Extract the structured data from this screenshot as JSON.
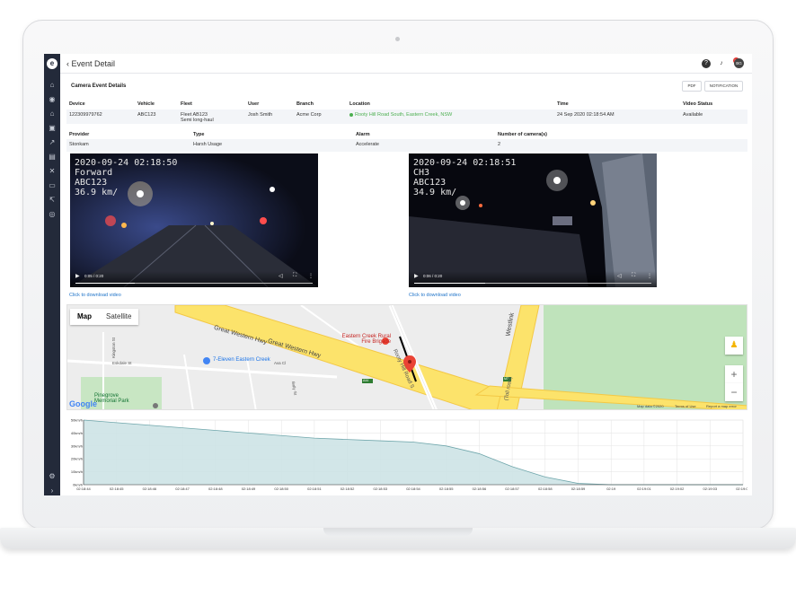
{
  "header": {
    "page_title": "Event Detail",
    "back_icon": "chevron-left-icon",
    "notification_count": "10",
    "avatar_initials": "BG",
    "help_icon": "question-icon",
    "bell_icon": "bell-icon"
  },
  "sidebar": {
    "logo": "e",
    "icons": [
      "home-icon",
      "globe-icon",
      "house-icon",
      "car-icon",
      "chart-icon",
      "document-icon",
      "tools-icon",
      "card-icon",
      "share-icon",
      "support-icon"
    ],
    "bottom_icons": [
      "gear-icon",
      "expand-icon"
    ]
  },
  "event": {
    "section_title": "Camera Event Details",
    "pdf_button": "PDF",
    "notification_button": "NOTIFICATION",
    "headers": [
      "Device",
      "Vehicle",
      "Fleet",
      "User",
      "Branch",
      "Location",
      "Time",
      "Video Status"
    ],
    "device": "122309979762",
    "vehicle": "ABC123",
    "fleet_line1": "Fleet AB123",
    "fleet_line2": "Semi long-haul",
    "user": "Josh Smith",
    "branch": "Acme Corp",
    "location": "Rooty Hill Road South, Eastern Creek, NSW",
    "time": "24 Sep 2020 02:18:54 AM",
    "video_status": "Available",
    "headers2": [
      "Provider",
      "Type",
      "Alarm",
      "Number of camera(s)"
    ],
    "provider": "Stonkam",
    "type": "Harsh Usage",
    "alarm": "Accelerate",
    "camera_count": "2"
  },
  "videos": [
    {
      "overlay": "2020-09-24 02:18:50\nForward\nABC123\n36.9 km/",
      "time": "0:05 / 0:20",
      "progress": 0.25,
      "download": "Click to download video"
    },
    {
      "overlay": "2020-09-24 02:18:51\nCH3\nABC123\n34.9 km/",
      "time": "0:06 / 0:20",
      "progress": 0.3,
      "download": "Click to download video"
    }
  ],
  "map": {
    "tab_map": "Map",
    "tab_satellite": "Satellite",
    "roads": [
      "Great Western Hwy",
      "Great Western Hwy",
      "Westlink",
      "Rooty Hill Road S",
      "(Toll road)",
      "Kingston St",
      "Eskdale St",
      "Ava Cl",
      "Bally St"
    ],
    "pois": [
      "7-Eleven Eastern Creek",
      "Eastern Creek Rural Fire Brigade",
      "Pinegrove Memorial Park"
    ],
    "shields": [
      "A44",
      "M7"
    ],
    "google": "Google",
    "footer": [
      "Map data ©2020",
      "Terms of Use",
      "Report a map error"
    ],
    "zoom_in": "+",
    "zoom_out": "−"
  },
  "chart_data": {
    "type": "area",
    "ylabel": "",
    "yticks": [
      "50km/h",
      "40km/h",
      "30km/h",
      "20km/h",
      "10km/h",
      "0km/h"
    ],
    "ylim": [
      0,
      50
    ],
    "x": [
      "02:18:44",
      "02:18:45",
      "02:18:46",
      "02:18:47",
      "02:18:48",
      "02:18:49",
      "02:18:50",
      "02:18:51",
      "02:18:52",
      "02:18:53",
      "02:18:54",
      "02:18:55",
      "02:18:56",
      "02:18:57",
      "02:18:58",
      "02:18:59",
      "02:19",
      "02:19:01",
      "02:19:02",
      "02:19:03",
      "02:19:04"
    ],
    "values": [
      50,
      48,
      46,
      44,
      42,
      40,
      38,
      36,
      35,
      34,
      33,
      30,
      24,
      14,
      6,
      1,
      0,
      0,
      0,
      0,
      0
    ],
    "colors": {
      "fill": "#cde3e5",
      "line": "#6fa6ab"
    }
  }
}
